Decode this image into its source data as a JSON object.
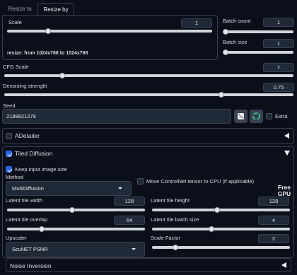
{
  "tabs": [
    {
      "label": "Resize to",
      "active": false
    },
    {
      "label": "Resize by",
      "active": true
    }
  ],
  "scale": {
    "label": "Scale",
    "value": "1",
    "level": 0.2
  },
  "resize_info": "resize: from 1024x768 to 1024x768",
  "batch_count": {
    "label": "Batch count",
    "value": "1",
    "level": 0.0
  },
  "batch_size": {
    "label": "Batch size",
    "value": "1",
    "level": 0.0
  },
  "cfg_scale": {
    "label": "CFG Scale",
    "value": "7",
    "level": 0.2
  },
  "denoising": {
    "label": "Denoising strength",
    "value": "0.75",
    "level": 0.75
  },
  "seed": {
    "label": "Seed",
    "value": "2189921279",
    "extra_label": "Extra",
    "extra_checked": false
  },
  "adetailer": {
    "label": "ADetailer",
    "checked": false
  },
  "tiled_diffusion": {
    "label": "Tiled Diffusion",
    "checked": true,
    "keep_size": {
      "label": "Keep input image size",
      "checked": true
    },
    "method": {
      "label": "Method",
      "value": "MultiDiffusion"
    },
    "move_controlnet": {
      "label": "Move ControlNet tensor to CPU (if applicable)",
      "checked": false
    },
    "free_gpu": {
      "line1": "Free",
      "line2": "GPU"
    },
    "latent_tile_width": {
      "label": "Latent tile width",
      "value": "128",
      "level": 0.47
    },
    "latent_tile_height": {
      "label": "Latent tile height",
      "value": "128",
      "level": 0.47
    },
    "latent_tile_overlap": {
      "label": "Latent tile overlap",
      "value": "64",
      "level": 0.25
    },
    "latent_tile_batch_size": {
      "label": "Latent tile batch size",
      "value": "4",
      "level": 0.43
    },
    "upscaler": {
      "label": "Upscaler",
      "value": "ScuNET PSNR"
    },
    "scale_factor": {
      "label": "Scale Factor",
      "value": "2",
      "level": 0.17
    }
  },
  "noise_inversion": {
    "label": "Noise Inversion"
  },
  "colors": {
    "accent": "#2563eb",
    "background": "#0b0f19",
    "panel": "#1f2937"
  }
}
